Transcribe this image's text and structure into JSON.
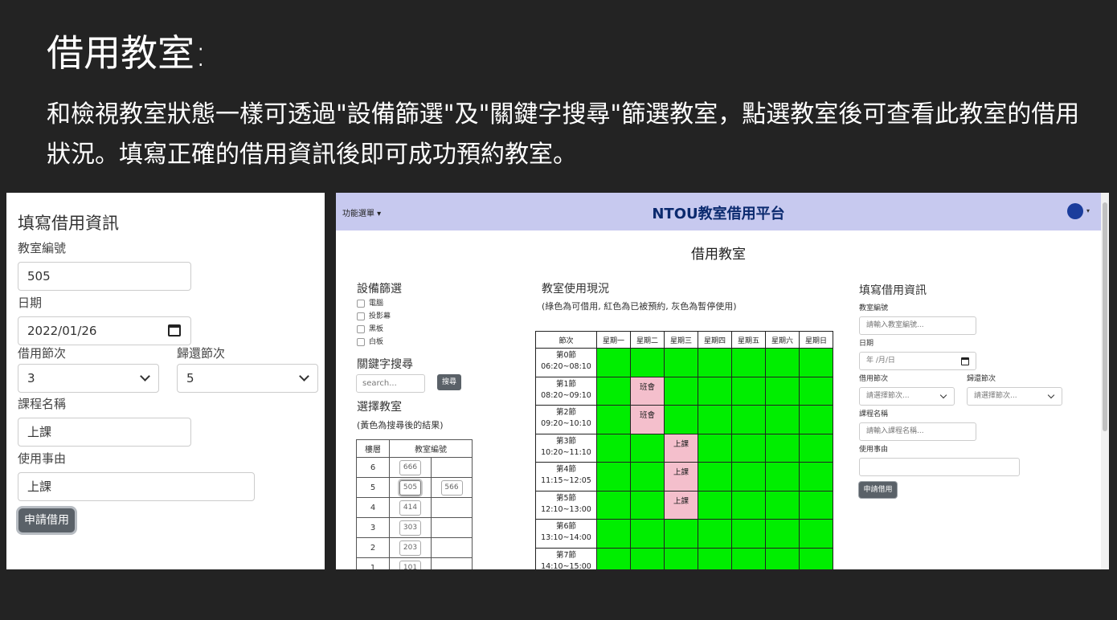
{
  "slide": {
    "title": "借用教室:",
    "description": "和檢視教室狀態一樣可透過\"設備篩選\"及\"關鍵字搜尋\"篩選教室，點選教室後可查看此教室的借用狀況。填寫正確的借用資訊後即可成功預約教室。"
  },
  "zoom_form": {
    "heading": "填寫借用資訊",
    "room_label": "教室編號",
    "room_value": "505",
    "date_label": "日期",
    "date_value": "2022/01/26",
    "period_label": "借用節次",
    "period_value": "3",
    "return_label": "歸還節次",
    "return_value": "5",
    "course_label": "課程名稱",
    "course_value": "上課",
    "reason_label": "使用事由",
    "reason_value": "上課",
    "submit_label": "申請借用"
  },
  "navbar": {
    "menu_label": "功能選單 ▾",
    "title": "NTOU教室借用平台",
    "caret": "▾"
  },
  "page_title": "借用教室",
  "filter": {
    "heading": "設備篩選",
    "items": [
      "電腦",
      "投影幕",
      "黑板",
      "白板"
    ]
  },
  "search": {
    "heading": "關鍵字搜尋",
    "placeholder": "search...",
    "button": "搜尋"
  },
  "room_select": {
    "heading": "選擇教室",
    "note": "(黃色為搜尋後的結果)",
    "col_floor": "樓層",
    "col_room": "教室編號",
    "rows": [
      {
        "floor": "6",
        "rooms": [
          "666",
          ""
        ]
      },
      {
        "floor": "5",
        "rooms": [
          "505",
          "566"
        ]
      },
      {
        "floor": "4",
        "rooms": [
          "414",
          ""
        ]
      },
      {
        "floor": "3",
        "rooms": [
          "303",
          ""
        ]
      },
      {
        "floor": "2",
        "rooms": [
          "203",
          ""
        ]
      },
      {
        "floor": "1",
        "rooms": [
          "101",
          ""
        ]
      }
    ]
  },
  "usage": {
    "heading": "教室使用現況",
    "note": "(綠色為可借用, 紅色為已被預約, 灰色為暫停使用)",
    "headers": [
      "節次",
      "星期一",
      "星期二",
      "星期三",
      "星期四",
      "星期五",
      "星期六",
      "星期日"
    ],
    "rows": [
      {
        "name": "第0節",
        "time": "06:20~08:10",
        "cells": [
          "",
          "",
          "",
          "",
          "",
          "",
          ""
        ]
      },
      {
        "name": "第1節",
        "time": "08:20~09:10",
        "cells": [
          "",
          "班會",
          "",
          "",
          "",
          "",
          ""
        ]
      },
      {
        "name": "第2節",
        "time": "09:20~10:10",
        "cells": [
          "",
          "班會",
          "",
          "",
          "",
          "",
          ""
        ]
      },
      {
        "name": "第3節",
        "time": "10:20~11:10",
        "cells": [
          "",
          "",
          "上課",
          "",
          "",
          "",
          ""
        ]
      },
      {
        "name": "第4節",
        "time": "11:15~12:05",
        "cells": [
          "",
          "",
          "上課",
          "",
          "",
          "",
          ""
        ]
      },
      {
        "name": "第5節",
        "time": "12:10~13:00",
        "cells": [
          "",
          "",
          "上課",
          "",
          "",
          "",
          ""
        ]
      },
      {
        "name": "第6節",
        "time": "13:10~14:00",
        "cells": [
          "",
          "",
          "",
          "",
          "",
          "",
          ""
        ]
      },
      {
        "name": "第7節",
        "time": "14:10~15:00",
        "cells": [
          "",
          "",
          "",
          "",
          "",
          "",
          ""
        ]
      }
    ],
    "colors": {
      "available": "#00ee00",
      "booked": "#f4bfcc"
    }
  },
  "booking_form": {
    "heading": "填寫借用資訊",
    "room_label": "教室編號",
    "room_placeholder": "請輸入教室編號...",
    "date_label": "日期",
    "date_placeholder": "年 /月/日",
    "period_label": "借用節次",
    "period_placeholder": "請選擇節次...",
    "return_label": "歸還節次",
    "return_placeholder": "請選擇節次...",
    "course_label": "課程名稱",
    "course_placeholder": "請輸入課程名稱...",
    "reason_label": "使用事由",
    "submit_label": "申請借用"
  }
}
